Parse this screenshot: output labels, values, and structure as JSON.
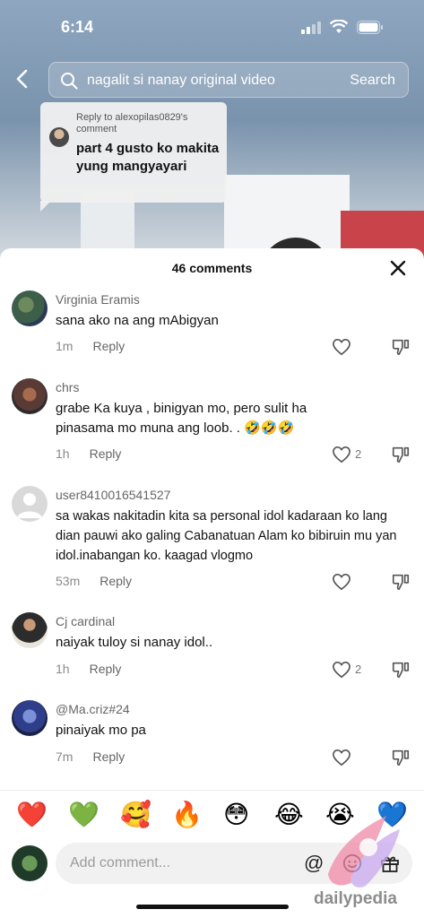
{
  "status": {
    "time": "6:14"
  },
  "search": {
    "query": "nagalit si nanay original video",
    "button": "Search"
  },
  "reply_bubble": {
    "reply_to": "Reply to alexopilas0829's comment",
    "text": "part 4 gusto ko makita yung mangyayari"
  },
  "sheet": {
    "title": "46 comments"
  },
  "comments": [
    {
      "user": "Virginia Eramis",
      "text": "sana ako na ang mAbigyan",
      "time": "1m",
      "reply": "Reply",
      "likes": ""
    },
    {
      "user": "chrs",
      "text": "grabe Ka kuya , binigyan mo, pero sulit ha pinasama mo muna ang loob. . 🤣🤣🤣",
      "time": "1h",
      "reply": "Reply",
      "likes": "2"
    },
    {
      "user": "user8410016541527",
      "text": "sa wakas nakitadin kita sa personal idol kadaraan ko lang dian pauwi ako galing Cabanatuan Alam ko bibiruin mu yan idol.inabangan ko. kaagad vlogmo",
      "time": "53m",
      "reply": "Reply",
      "likes": ""
    },
    {
      "user": "Cj cardinal",
      "text": "naiyak tuloy si nanay idol..",
      "time": "1h",
      "reply": "Reply",
      "likes": "2"
    },
    {
      "user": "@Ma.criz#24",
      "text": "pinaiyak mo pa",
      "time": "7m",
      "reply": "Reply",
      "likes": ""
    }
  ],
  "emojis": [
    "❤️",
    "💚",
    "🥰",
    "🔥",
    "😳",
    "😂",
    "😭",
    "💙"
  ],
  "composer": {
    "placeholder": "Add comment...",
    "at": "@"
  },
  "watermark": "dailypedia"
}
